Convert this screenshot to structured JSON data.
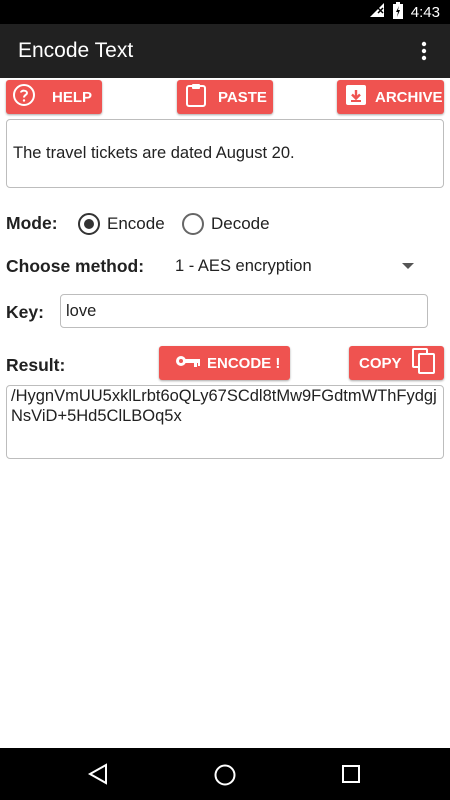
{
  "status_bar": {
    "time": "4:43"
  },
  "app_bar": {
    "title": "Encode Text"
  },
  "toolbar": {
    "help": "HELP",
    "paste": "PASTE",
    "archive": "ARCHIVE"
  },
  "input": {
    "text": "The travel tickets are dated August 20."
  },
  "mode": {
    "label": "Mode:",
    "options": [
      "Encode",
      "Decode"
    ],
    "selected": "Encode"
  },
  "method": {
    "label": "Choose method:",
    "selected": "1 - AES encryption"
  },
  "key": {
    "label": "Key:",
    "value": "love"
  },
  "result": {
    "label": "Result:",
    "encode_button": "ENCODE !",
    "copy_button": "COPY",
    "value": "/HygnVmUU5xklLrbt6oQLy67SCdl8tMw9FGdtmWThFydgjNsViD+5Hd5ClLBOq5x"
  },
  "colors": {
    "accent": "#ef5350",
    "app_bar": "#212121",
    "status_bar": "#000000"
  }
}
